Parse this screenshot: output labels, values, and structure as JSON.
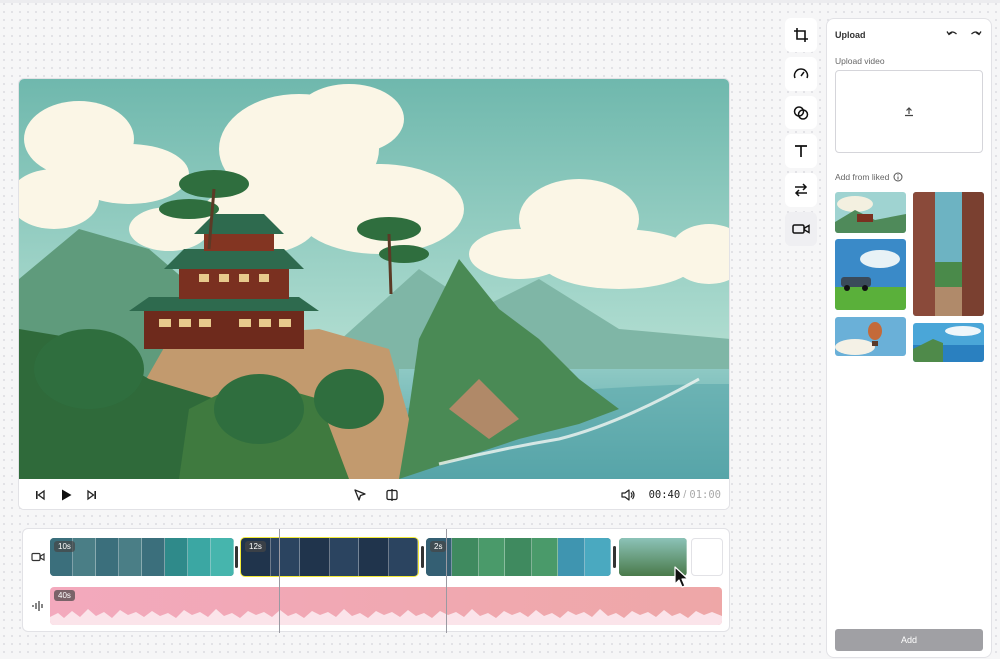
{
  "player": {
    "current_time": "00:40",
    "separator": "/",
    "total_time": "01:00"
  },
  "timeline": {
    "video_clips": [
      {
        "badge": "10s",
        "selected": false
      },
      {
        "badge": "12s",
        "selected": true
      },
      {
        "badge": "2s",
        "selected": false
      },
      {
        "badge": "",
        "selected": false
      }
    ],
    "audio_clip": {
      "badge": "40s"
    }
  },
  "tools": [
    {
      "icon": "crop-icon"
    },
    {
      "icon": "speed-icon"
    },
    {
      "icon": "overlay-icon"
    },
    {
      "icon": "text-icon"
    },
    {
      "icon": "transition-icon"
    },
    {
      "icon": "video-icon",
      "active": true
    }
  ],
  "panel": {
    "title": "Upload",
    "upload_label": "Upload video",
    "liked_label": "Add from liked",
    "add_button": "Add"
  },
  "colors": {
    "selection": "#f3ea38",
    "audio": "#f0a8b4",
    "add_button": "#a0a0a4"
  }
}
